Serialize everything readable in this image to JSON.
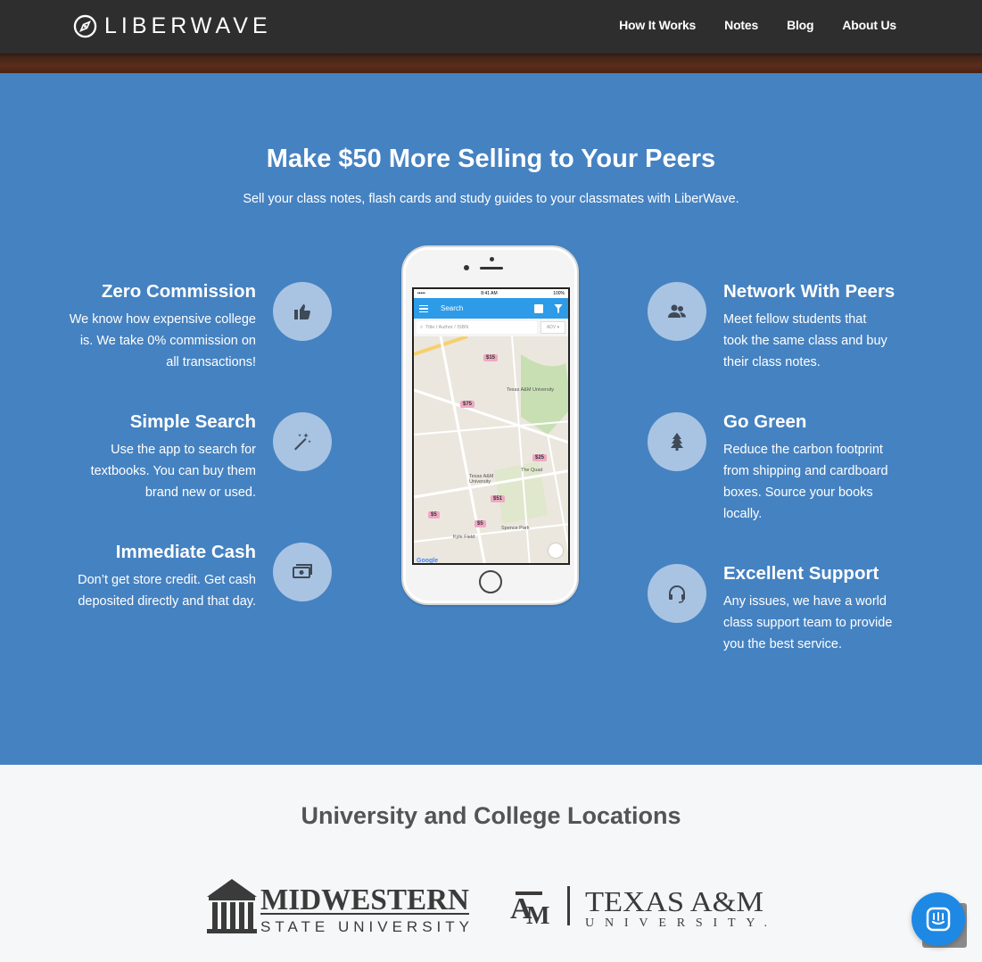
{
  "nav": {
    "brand": "LIBERWAVE",
    "links": [
      "How It Works",
      "Notes",
      "Blog",
      "About Us"
    ]
  },
  "features": {
    "title": "Make $50 More Selling to Your Peers",
    "subtitle": "Sell your class notes, flash cards and study guides to your classmates with LiberWave.",
    "left": [
      {
        "title": "Zero Commission",
        "desc": "We know how expensive college is.  We take 0% commission on all transactions!",
        "icon": "thumbs-up-icon"
      },
      {
        "title": "Simple Search",
        "desc": "Use the app to search for textbooks. You can buy them brand new or used.",
        "icon": "magic-wand-icon"
      },
      {
        "title": "Immediate Cash",
        "desc": "Don’t get store credit. Get cash deposited directly and that day.",
        "icon": "money-icon"
      }
    ],
    "right": [
      {
        "title": "Network With Peers",
        "desc": "Meet fellow students that took the same class and buy their class notes.",
        "icon": "users-icon"
      },
      {
        "title": "Go Green",
        "desc": "Reduce the carbon footprint from shipping and cardboard boxes.  Source your books locally.",
        "icon": "tree-icon"
      },
      {
        "title": "Excellent Support",
        "desc": "Any issues, we have a world class support team to provide you the best service.",
        "icon": "headset-icon"
      }
    ]
  },
  "phone": {
    "status_left": "•••••  ",
    "status_time": "8:41 AM",
    "status_right": "100%",
    "app_title": "Search",
    "search_placeholder": "Title / Author / ISBN",
    "adv_label": "ADV ▾",
    "pins": [
      "$15",
      "$75",
      "$25",
      "$51",
      "$5",
      "$5"
    ],
    "labels": [
      "Texas A&M University",
      "Texas A&M University",
      "The Quad",
      "Spence Park",
      "Kyle Field"
    ],
    "google": "Google"
  },
  "locations": {
    "title": "University and College Locations",
    "logos": [
      "MIDWESTERN STATE UNIVERSITY",
      "TEXAS A&M UNIVERSITY"
    ]
  },
  "colors": {
    "features_bg": "#4582c1",
    "icon_circle": "#a9c4e2",
    "nav_bg": "#2e2e2e",
    "chat": "#1e88e5"
  }
}
